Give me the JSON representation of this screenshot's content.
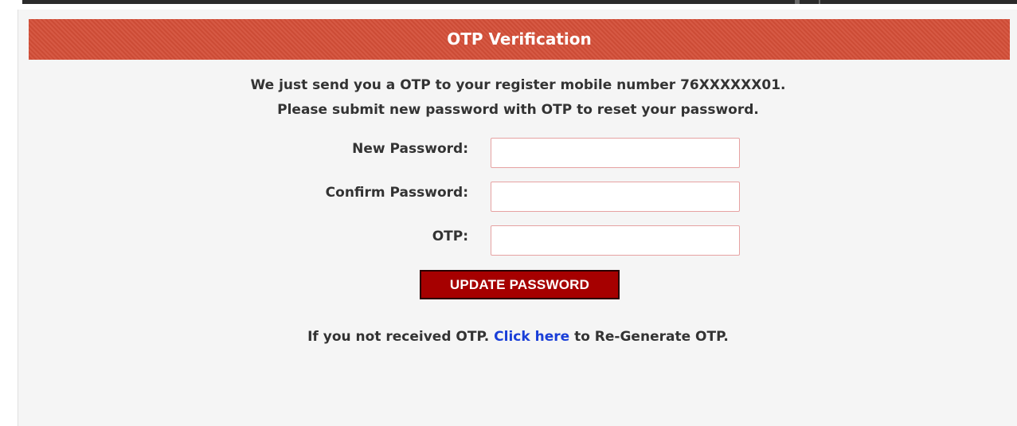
{
  "header": {
    "title": "OTP Verification"
  },
  "message": {
    "line1": "We just send you a OTP to your register mobile number 76XXXXXX01.",
    "line2": "Please submit new password with OTP to reset your password."
  },
  "form": {
    "new_password": {
      "label": "New Password:",
      "value": ""
    },
    "confirm_password": {
      "label": "Confirm Password:",
      "value": ""
    },
    "otp": {
      "label": "OTP:",
      "value": ""
    },
    "submit_label": "UPDATE PASSWORD"
  },
  "regenerate": {
    "before": "If you not received OTP.",
    "link": "Click here",
    "after": "to Re-Generate OTP."
  },
  "colors": {
    "header_bg": "#d44f38",
    "button_bg": "#a60000",
    "link": "#1a3fd8",
    "input_border": "#e6a2a2"
  }
}
